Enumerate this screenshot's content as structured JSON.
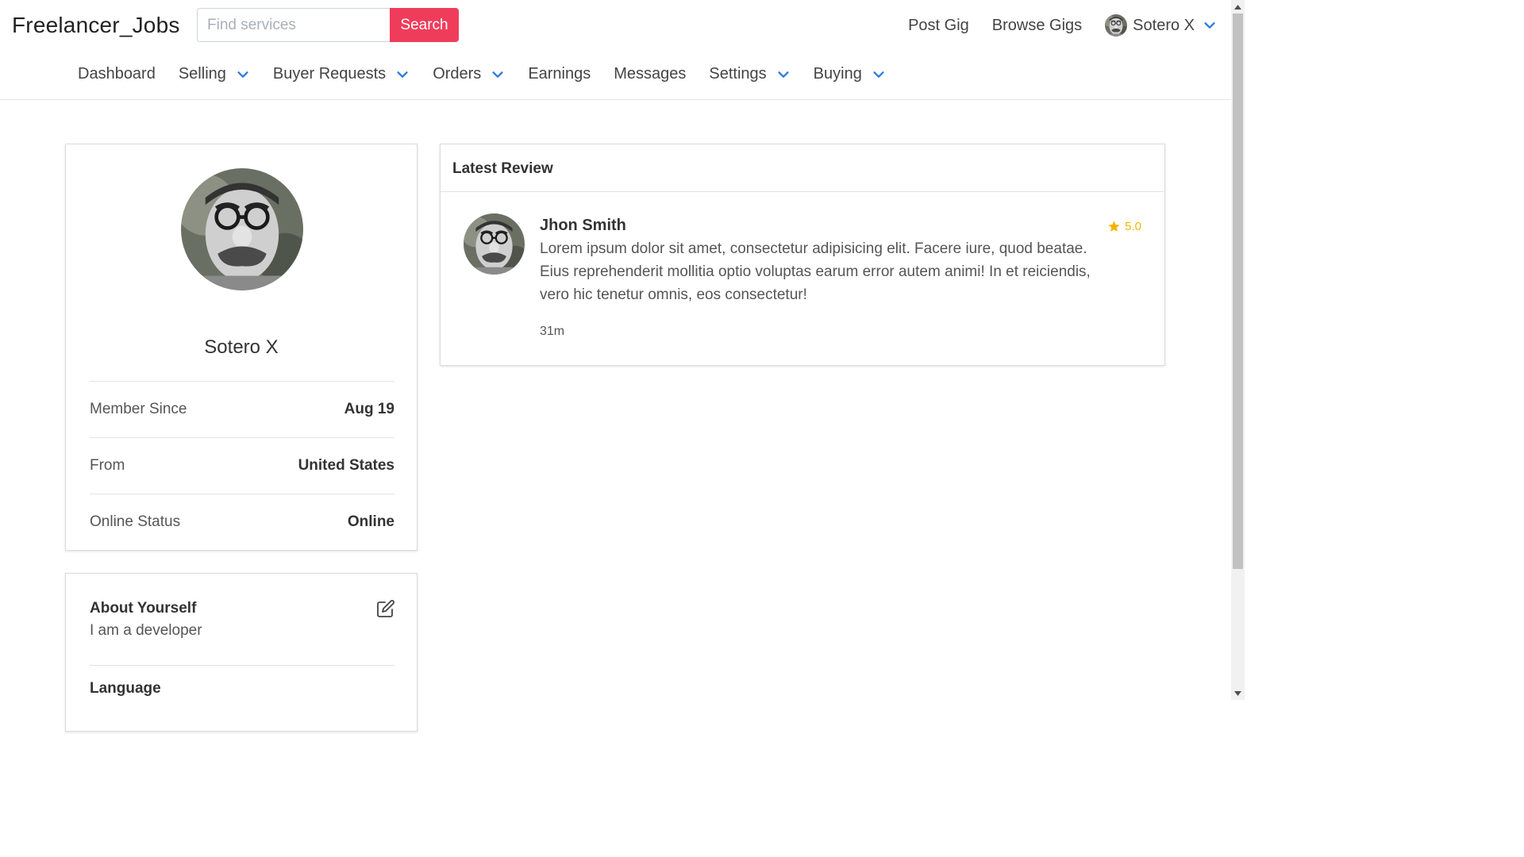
{
  "header": {
    "brand": "Freelancer_Jobs",
    "search_placeholder": "Find services",
    "search_button": "Search",
    "post_gig": "Post Gig",
    "browse_gigs": "Browse Gigs",
    "user_name": "Sotero X"
  },
  "subnav": {
    "dashboard": "Dashboard",
    "selling": "Selling",
    "buyer_requests": "Buyer Requests",
    "orders": "Orders",
    "earnings": "Earnings",
    "messages": "Messages",
    "settings": "Settings",
    "buying": "Buying"
  },
  "profile": {
    "name": "Sotero X",
    "rows": [
      {
        "label": "Member Since",
        "value": "Aug 19"
      },
      {
        "label": "From",
        "value": "United States"
      },
      {
        "label": "Online Status",
        "value": "Online"
      }
    ]
  },
  "about": {
    "title": "About Yourself",
    "text": "I am a developer",
    "language_title": "Language"
  },
  "review": {
    "header": "Latest Review",
    "reviewer": "Jhon Smith",
    "rating": "5.0",
    "text": "Lorem ipsum dolor sit amet, consectetur adipisicing elit. Facere iure, quod beatae. Eius reprehenderit mollitia optio voluptas earum error autem animi! In et reiciendis, vero hic tenetur omnis, eos consectetur!",
    "time": "31m"
  },
  "colors": {
    "accent": "#f03c5b",
    "chevron": "#2d7be0",
    "star": "#f5b301"
  }
}
